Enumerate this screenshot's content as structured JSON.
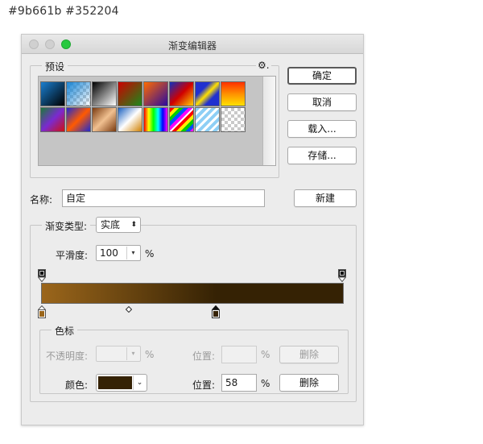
{
  "caption": "#9b661b  #352204",
  "window": {
    "title": "渐变编辑器"
  },
  "presets": {
    "label": "预设",
    "gear": "⚙."
  },
  "buttons": {
    "ok": "确定",
    "cancel": "取消",
    "load": "载入...",
    "save": "存储...",
    "new": "新建"
  },
  "name_field": {
    "label": "名称:",
    "value": "自定"
  },
  "gradient_type": {
    "label": "渐变类型:",
    "value": "实底"
  },
  "smoothness": {
    "label": "平滑度:",
    "value": "100",
    "unit": "%"
  },
  "stops": {
    "label": "色标",
    "opacity_label": "不透明度:",
    "opacity_unit": "%",
    "position_label": "位置:",
    "position_unit": "%",
    "delete_label": "删除",
    "color_label": "颜色:",
    "color_value": "#352204",
    "color_position": "58",
    "color_position_unit": "%",
    "color_delete_label": "删除"
  },
  "gradient": {
    "start_color": "#9b661b",
    "end_color": "#352204",
    "stops_positions": [
      0,
      58,
      100
    ]
  }
}
